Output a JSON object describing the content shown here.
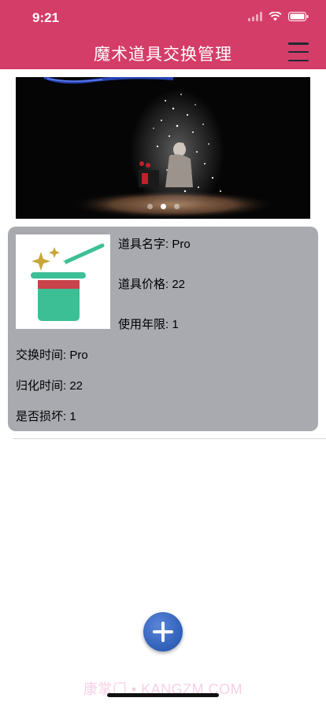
{
  "status_bar": {
    "time": "9:21"
  },
  "nav": {
    "title": "魔术道具交换管理"
  },
  "banner": {
    "slide_count": 3,
    "active_slide": 2
  },
  "item": {
    "name_label": "道具名字: Pro",
    "price_label": "道具价格: 22",
    "years_label": "使用年限: 1",
    "exchange_time_label": "交换时间: Pro",
    "return_time_label": "归化时间: 22",
    "damaged_label": "是否损坏: 1"
  },
  "watermark": "康掌门 • KANGZM.COM",
  "colors": {
    "header": "#d43d68",
    "card": "#a9aab0",
    "add_button": "#2f5fb8"
  }
}
